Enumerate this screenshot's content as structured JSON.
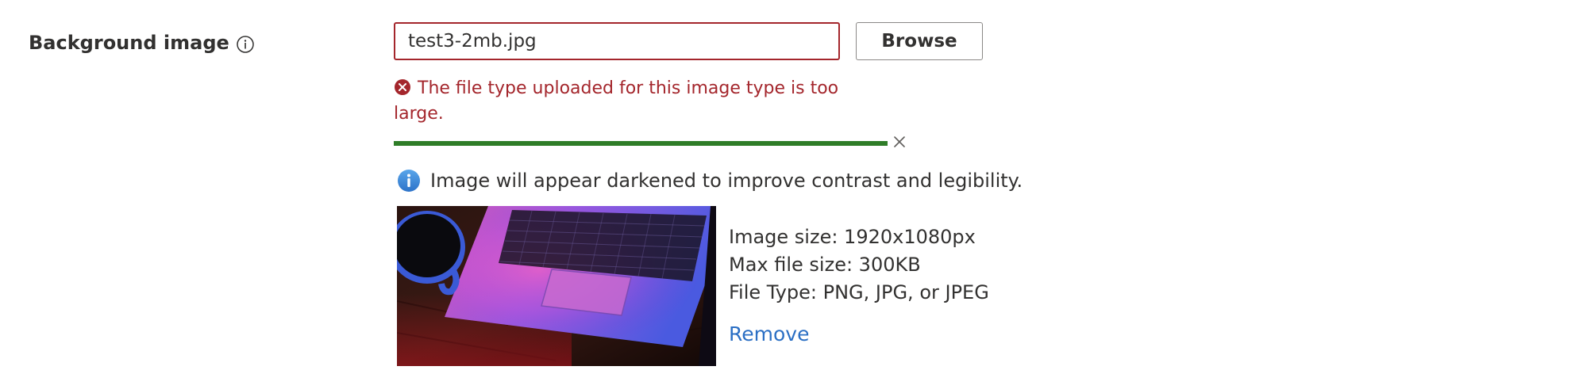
{
  "field": {
    "label": "Background image",
    "info_icon": "info-circle-outline-icon"
  },
  "file_input": {
    "value": "test3-2mb.jpg",
    "placeholder": ""
  },
  "browse_button": {
    "label": "Browse"
  },
  "error": {
    "icon": "error-circle-icon",
    "message": "The file type uploaded for this image type is too large."
  },
  "upload_progress": {
    "fraction": 1.0,
    "cancel_icon": "close-icon"
  },
  "notice": {
    "icon": "info-icon",
    "text": "Image will appear darkened to improve contrast and legibility."
  },
  "preview": {
    "image_subject": "laptop-and-coffee-cup-photo"
  },
  "image_info": {
    "size": "Image size: 1920x1080px",
    "max_file_size": "Max file size: 300KB",
    "file_type": "File Type: PNG, JPG, or JPEG"
  },
  "remove_link": {
    "label": "Remove"
  },
  "colors": {
    "error": "#a4262c",
    "progress": "#2f7d28",
    "link": "#2b6fc4",
    "info_badge": "#3a86d9",
    "text": "#323130"
  }
}
